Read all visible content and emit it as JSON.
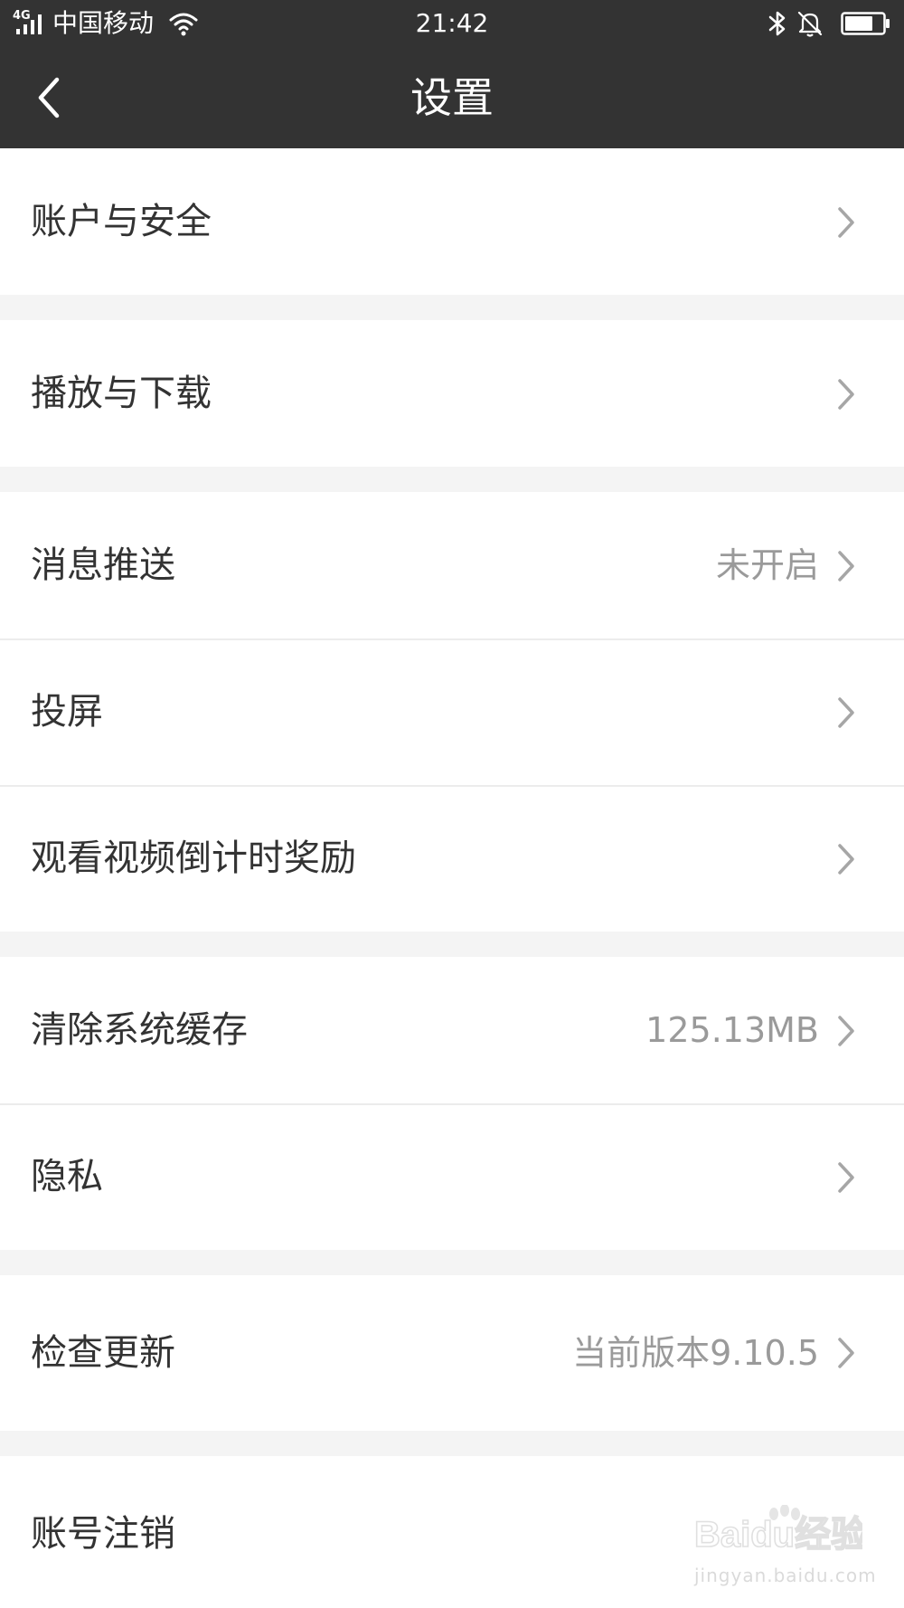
{
  "status_bar": {
    "network": "4G",
    "carrier": "中国移动",
    "time": "21:42"
  },
  "header": {
    "title": "设置",
    "back_icon": "chevron-left-icon"
  },
  "icons": {
    "signal": "signal-icon",
    "wifi": "wifi-icon",
    "bluetooth": "bluetooth-icon",
    "mute": "bell-mute-icon",
    "battery": "battery-icon",
    "row_chevron": "chevron-right-icon"
  },
  "battery_level": 0.75,
  "groups": [
    {
      "items": [
        {
          "label": "账户与安全",
          "value": ""
        }
      ]
    },
    {
      "items": [
        {
          "label": "播放与下载",
          "value": ""
        }
      ]
    },
    {
      "items": [
        {
          "label": "消息推送",
          "value": "未开启"
        },
        {
          "label": "投屏",
          "value": ""
        },
        {
          "label": "观看视频倒计时奖励",
          "value": ""
        }
      ]
    },
    {
      "items": [
        {
          "label": "清除系统缓存",
          "value": "125.13MB"
        },
        {
          "label": "隐私",
          "value": ""
        }
      ]
    },
    {
      "items": [
        {
          "label": "检查更新",
          "value": "当前版本9.10.5"
        }
      ]
    },
    {
      "items": [
        {
          "label": "账号注销",
          "value": ""
        }
      ]
    }
  ],
  "watermark": {
    "brand": "Baidu经验",
    "url": "jingyan.baidu.com"
  },
  "colors": {
    "topbar": "#333333",
    "background": "#f4f4f4",
    "text": "#333333",
    "secondary_text": "#9a9a9a",
    "chevron": "#a6a6a6"
  }
}
